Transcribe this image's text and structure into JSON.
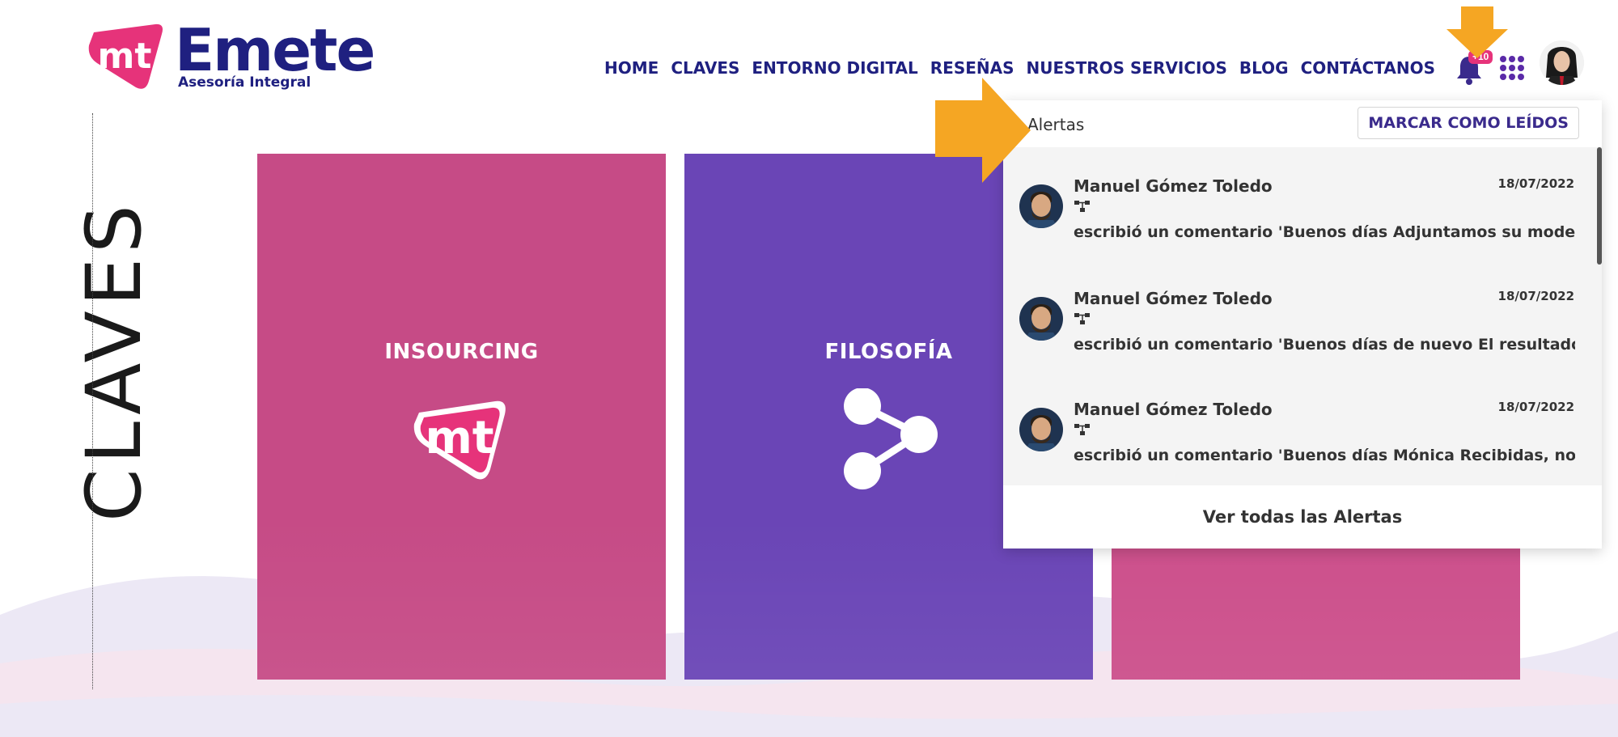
{
  "brand": {
    "logo_mark_text": "mt",
    "name": "Emete",
    "tagline": "Asesoría Integral",
    "primary_color": "#1f2080",
    "accent_color": "#e6337a"
  },
  "nav": {
    "items": [
      {
        "label": "HOME"
      },
      {
        "label": "CLAVES"
      },
      {
        "label": "ENTORNO DIGITAL"
      },
      {
        "label": "RESEÑAS"
      },
      {
        "label": "NUESTROS SERVICIOS"
      },
      {
        "label": "BLOG"
      },
      {
        "label": "CONTÁCTANOS"
      }
    ]
  },
  "notifications": {
    "badge": "+10",
    "icon": "bell-icon"
  },
  "apps_icon": "grid-icon",
  "section": {
    "title": "CLAVES"
  },
  "cards": [
    {
      "title": "INSOURCING",
      "icon": "mt-logo-icon",
      "color": "#c64b86"
    },
    {
      "title": "FILOSOFÍA",
      "icon": "share-icon",
      "color": "#6a45b6"
    },
    {
      "title": "",
      "icon": "",
      "color": "#cc4f8b"
    }
  ],
  "alerts_panel": {
    "title": "Alertas",
    "mark_read_label": "MARCAR COMO LEÍDOS",
    "footer_label": "Ver todas las Alertas",
    "items": [
      {
        "author": "Manuel Gómez Toledo",
        "date": "18/07/2022",
        "text": "escribió un comentario 'Buenos días Adjuntamos su modelo"
      },
      {
        "author": "Manuel Gómez Toledo",
        "date": "18/07/2022",
        "text": "escribió un comentario 'Buenos días de nuevo El resultado"
      },
      {
        "author": "Manuel Gómez Toledo",
        "date": "18/07/2022",
        "text": "escribió un comentario 'Buenos días Mónica Recibidas, nos"
      }
    ]
  },
  "annotation_color": "#f5a623"
}
